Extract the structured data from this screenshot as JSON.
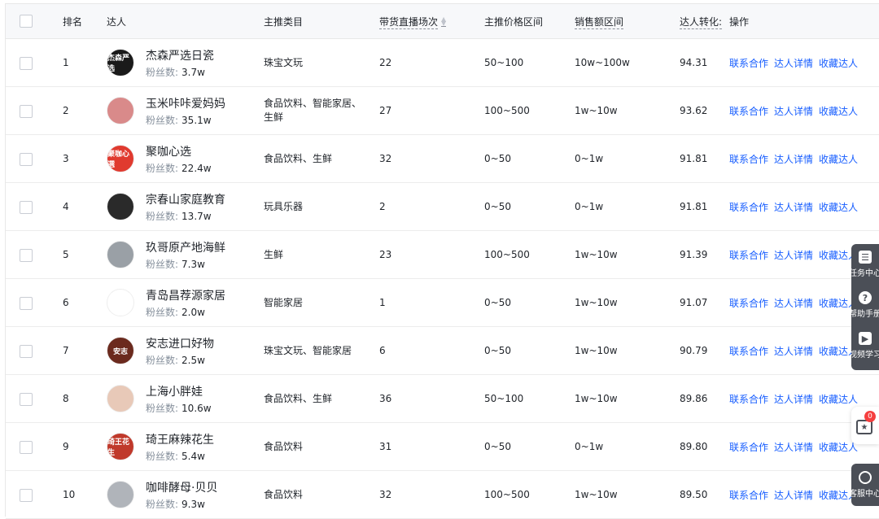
{
  "header": {
    "rank": "排名",
    "influencer": "达人",
    "category": "主推类目",
    "sessions": "带货直播场次",
    "price_range": "主推价格区间",
    "sales_range": "销售额区间",
    "conversion": "达人转化:",
    "actions": "操作"
  },
  "fans_label": "粉丝数:",
  "actions": {
    "contact": "联系合作",
    "detail": "达人详情",
    "collect": "收藏达人"
  },
  "rows": [
    {
      "rank": "1",
      "name": "杰森严选日瓷",
      "fans": "3.7w",
      "category": "珠宝文玩",
      "sessions": "22",
      "price": "50~100",
      "sales": "10w~100w",
      "conv": "94.31",
      "avatar_text": "杰森严选",
      "avatar_color": "#1a1a1a"
    },
    {
      "rank": "2",
      "name": "玉米咔咔爱妈妈",
      "fans": "35.1w",
      "category": "食品饮料、智能家居、生鲜",
      "sessions": "27",
      "price": "100~500",
      "sales": "1w~10w",
      "conv": "93.62",
      "avatar_text": "",
      "avatar_color": "#d98a8a"
    },
    {
      "rank": "3",
      "name": "聚咖心选",
      "fans": "22.4w",
      "category": "食品饮料、生鲜",
      "sessions": "32",
      "price": "0~50",
      "sales": "0~1w",
      "conv": "91.81",
      "avatar_text": "聚咖心選",
      "avatar_color": "#e03a2f"
    },
    {
      "rank": "4",
      "name": "宗春山家庭教育",
      "fans": "13.7w",
      "category": "玩具乐器",
      "sessions": "2",
      "price": "0~50",
      "sales": "0~1w",
      "conv": "91.81",
      "avatar_text": "",
      "avatar_color": "#2a2a2a"
    },
    {
      "rank": "5",
      "name": "玖哥原产地海鲜",
      "fans": "7.3w",
      "category": "生鲜",
      "sessions": "23",
      "price": "100~500",
      "sales": "1w~10w",
      "conv": "91.39",
      "avatar_text": "",
      "avatar_color": "#9aa0a6"
    },
    {
      "rank": "6",
      "name": "青岛昌荐源家居",
      "fans": "2.0w",
      "category": "智能家居",
      "sessions": "1",
      "price": "0~50",
      "sales": "1w~10w",
      "conv": "91.07",
      "avatar_text": "",
      "avatar_color": "#ffffff"
    },
    {
      "rank": "7",
      "name": "安志进口好物",
      "fans": "2.5w",
      "category": "珠宝文玩、智能家居",
      "sessions": "6",
      "price": "0~50",
      "sales": "1w~10w",
      "conv": "90.79",
      "avatar_text": "安志",
      "avatar_color": "#6b2a1e"
    },
    {
      "rank": "8",
      "name": "上海小胖娃",
      "fans": "10.6w",
      "category": "食品饮料、生鲜",
      "sessions": "36",
      "price": "50~100",
      "sales": "1w~10w",
      "conv": "89.86",
      "avatar_text": "",
      "avatar_color": "#e8c9b8"
    },
    {
      "rank": "9",
      "name": "琦王麻辣花生",
      "fans": "5.4w",
      "category": "食品饮料",
      "sessions": "31",
      "price": "0~50",
      "sales": "0~1w",
      "conv": "89.80",
      "avatar_text": "琦王花生",
      "avatar_color": "#c0392b"
    },
    {
      "rank": "10",
      "name": "咖啡酵母·贝贝",
      "fans": "9.3w",
      "category": "食品饮料",
      "sessions": "32",
      "price": "100~500",
      "sales": "1w~10w",
      "conv": "89.50",
      "avatar_text": "",
      "avatar_color": "#b0b4ba"
    }
  ],
  "side_rail": {
    "tasks": "任务中心",
    "help": "帮助手册",
    "video": "视频学习",
    "service": "客服中心",
    "fav_count": "0"
  }
}
